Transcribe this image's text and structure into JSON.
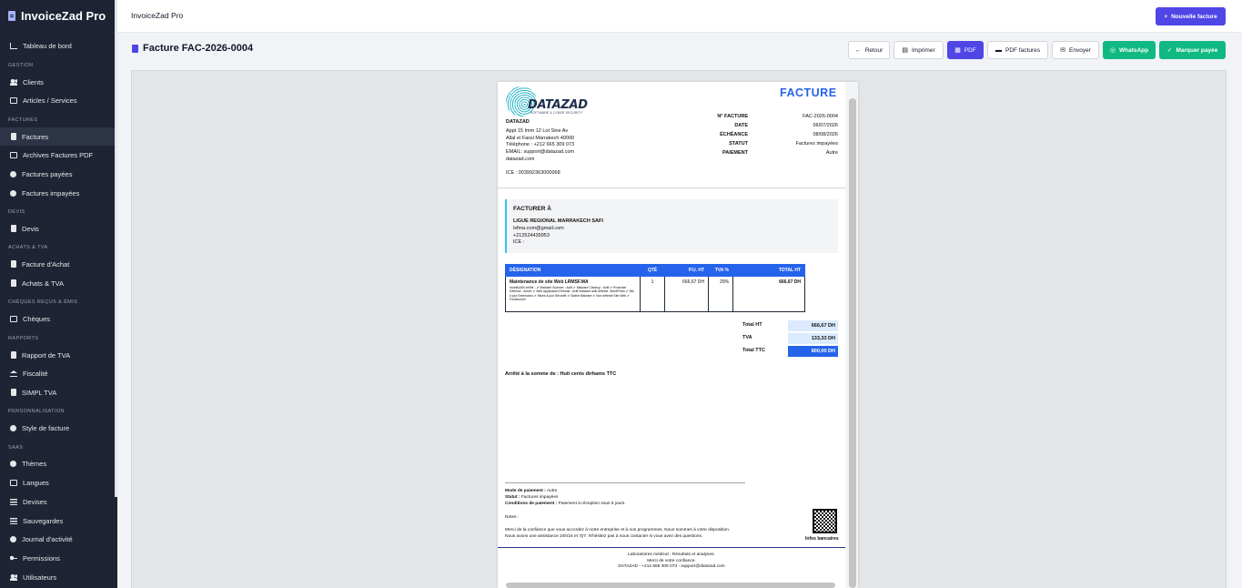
{
  "app": {
    "brand": "InvoiceZad Pro",
    "top_title": "InvoiceZad Pro",
    "new_invoice": "Nouvelle facture"
  },
  "sidebar": {
    "dashboard": "Tableau de bord",
    "sections": [
      "GESTION",
      "FACTURES",
      "DEVIS",
      "ACHATS & TVA",
      "CHÈQUES REÇUS & ÉMIS",
      "RAPPORTS",
      "PERSONNALISATION",
      "SAAS"
    ],
    "items": [
      "Clients",
      "Articles / Services",
      "Factures",
      "Archives Factures PDF",
      "Factures payées",
      "Factures impayées",
      "Devis",
      "Facture d'Achat",
      "Achats & TVA",
      "Chèques",
      "Rapport de TVA",
      "Fiscalité",
      "SIMPL TVA",
      "Style de facture",
      "Thèmes",
      "Langues",
      "Devises",
      "Sauvegardes",
      "Journal d'activité",
      "Permissions",
      "Utilisateurs"
    ]
  },
  "page": {
    "title": "Facture FAC-2026-0004"
  },
  "actions": {
    "back": "Retour",
    "print": "Imprimer",
    "pdf": "PDF",
    "pdf_invoices": "PDF factures",
    "send": "Envoyer",
    "whatsapp": "WhatsApp",
    "mark_paid": "Marquer payée"
  },
  "invoice": {
    "logo_name": "DATAZAD",
    "logo_tagline": "SOFTWARE & CYBER SECURITY",
    "company": {
      "name": "DATAZAD",
      "address1": "Appt 15 Imm 12 Lot Sine Av",
      "address2": "Allal el Fassi Marrakech 40000",
      "phone": "Téléphone : +212 665 309 073",
      "email": "EMAIL: support@datazad.com",
      "website": "datazad.com",
      "ice": "ICE : 003992363000068"
    },
    "heading": "FACTURE",
    "meta": [
      {
        "k": "N° FACTURE",
        "v": "FAC-2026-0004"
      },
      {
        "k": "DATE",
        "v": "06/07/2026"
      },
      {
        "k": "ÉCHÉANCE",
        "v": "08/08/2026"
      },
      {
        "k": "STATUT",
        "v": "Factures impayées"
      },
      {
        "k": "PAIEMENT",
        "v": "Autre"
      }
    ],
    "bill_to": {
      "label": "FACTURER À",
      "name": "LIGUE REGIONAL MARRAKECH SAFI",
      "email": "lsfma.com@gmail.com",
      "phone": "+212524439953",
      "ice": "ICE :"
    },
    "table": {
      "headers": [
        "DÉSIGNATION",
        "QTÉ",
        "P.U. HT",
        "TVA %",
        "TOTAL HT"
      ],
      "row": {
        "title": "Maintenance de site Web LRMSF.MA",
        "desc": "Imunify360 vérifié - ✔ Malware Scanner : Actif ✔ Malware Cleanup : Actif ✔ Proactive Defense : Active ✔ Web Application Firewall : Actif malware actif détecté. WordPress ✔ Mis à jour Extensions ✔ Mises à jour Sécurité ✔ Stable Malware ✔ Non détecté Site Web ✔ Fonctionnel",
        "qty": "1",
        "unit": "666,67 DH",
        "tva": "20%",
        "total": "666,67 DH"
      }
    },
    "totals": [
      {
        "k": "Total HT",
        "v": "666,67 DH"
      },
      {
        "k": "TVA",
        "v": "133,33 DH"
      },
      {
        "k": "Total TTC",
        "v": "800,00 DH"
      }
    ],
    "amount_words": "Arrêté à la somme de : Huit cents dirhams TTC",
    "payment_mode_label": "Mode de paiement :",
    "payment_mode": "Autre",
    "status_label": "Statut :",
    "status": "Factures impayées",
    "conditions_label": "Conditions de paiement :",
    "conditions": "Paiement à réception sous 5 jours.",
    "notes_label": "Notes :",
    "thanks1": "Merci de la confiance que vous accordez à notre entreprise et à nos programmes. Nous sommes à votre disposition.",
    "thanks2": "Nous avons une assistance 24h/24 et 7j/7. N'hésitez pas à nous contacter si vous avez des questions.",
    "bank_info": "Infos bancaires",
    "footer1": "Laboratoires médical - Résultats et analyses.",
    "footer2": "Merci de votre confiance.",
    "footer3": "DATAZAD - +212 665 309 073 - support@datazad.com"
  },
  "colors": {
    "sidebar_bg": "#1e2433",
    "primary": "#4f46e5",
    "invoice_blue": "#2563eb",
    "success": "#10b981"
  }
}
